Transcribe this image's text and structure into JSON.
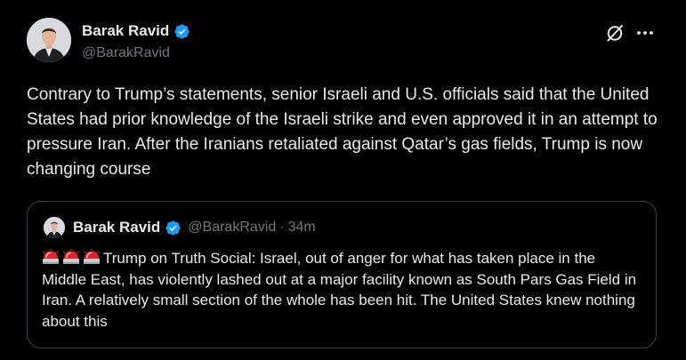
{
  "tweet": {
    "display_name": "Barak Ravid",
    "handle": "@BarakRavid",
    "verified": true,
    "text": "Contrary to Trump’s statements, senior Israeli and U.S. officials said that the United States had prior knowledge of the Israeli strike and even approved it in an attempt to pressure Iran. After the Iranians retaliated against Qatar’s gas fields, Trump is now changing course",
    "actions": {
      "grok_icon": "grok-icon",
      "more_icon": "more-options-icon",
      "more_glyph": "···"
    }
  },
  "quote": {
    "display_name": "Barak Ravid",
    "handle": "@BarakRavid",
    "separator": "·",
    "time": "34m",
    "verified": true,
    "emoji": [
      "police-car-light",
      "police-car-light",
      "police-car-light"
    ],
    "text": "Trump on Truth Social: Israel, out of anger for what has taken place in the Middle East, has violently lashed out at a major facility known as South Pars Gas Field in Iran. A relatively small section of the whole has been hit. The United States knew nothing about this"
  },
  "colors": {
    "background": "#000000",
    "text_primary": "#e7e9ea",
    "text_secondary": "#71767b",
    "verified_badge": "#1d9bf0",
    "border": "#3a3f45",
    "siren": "#e0242b"
  }
}
